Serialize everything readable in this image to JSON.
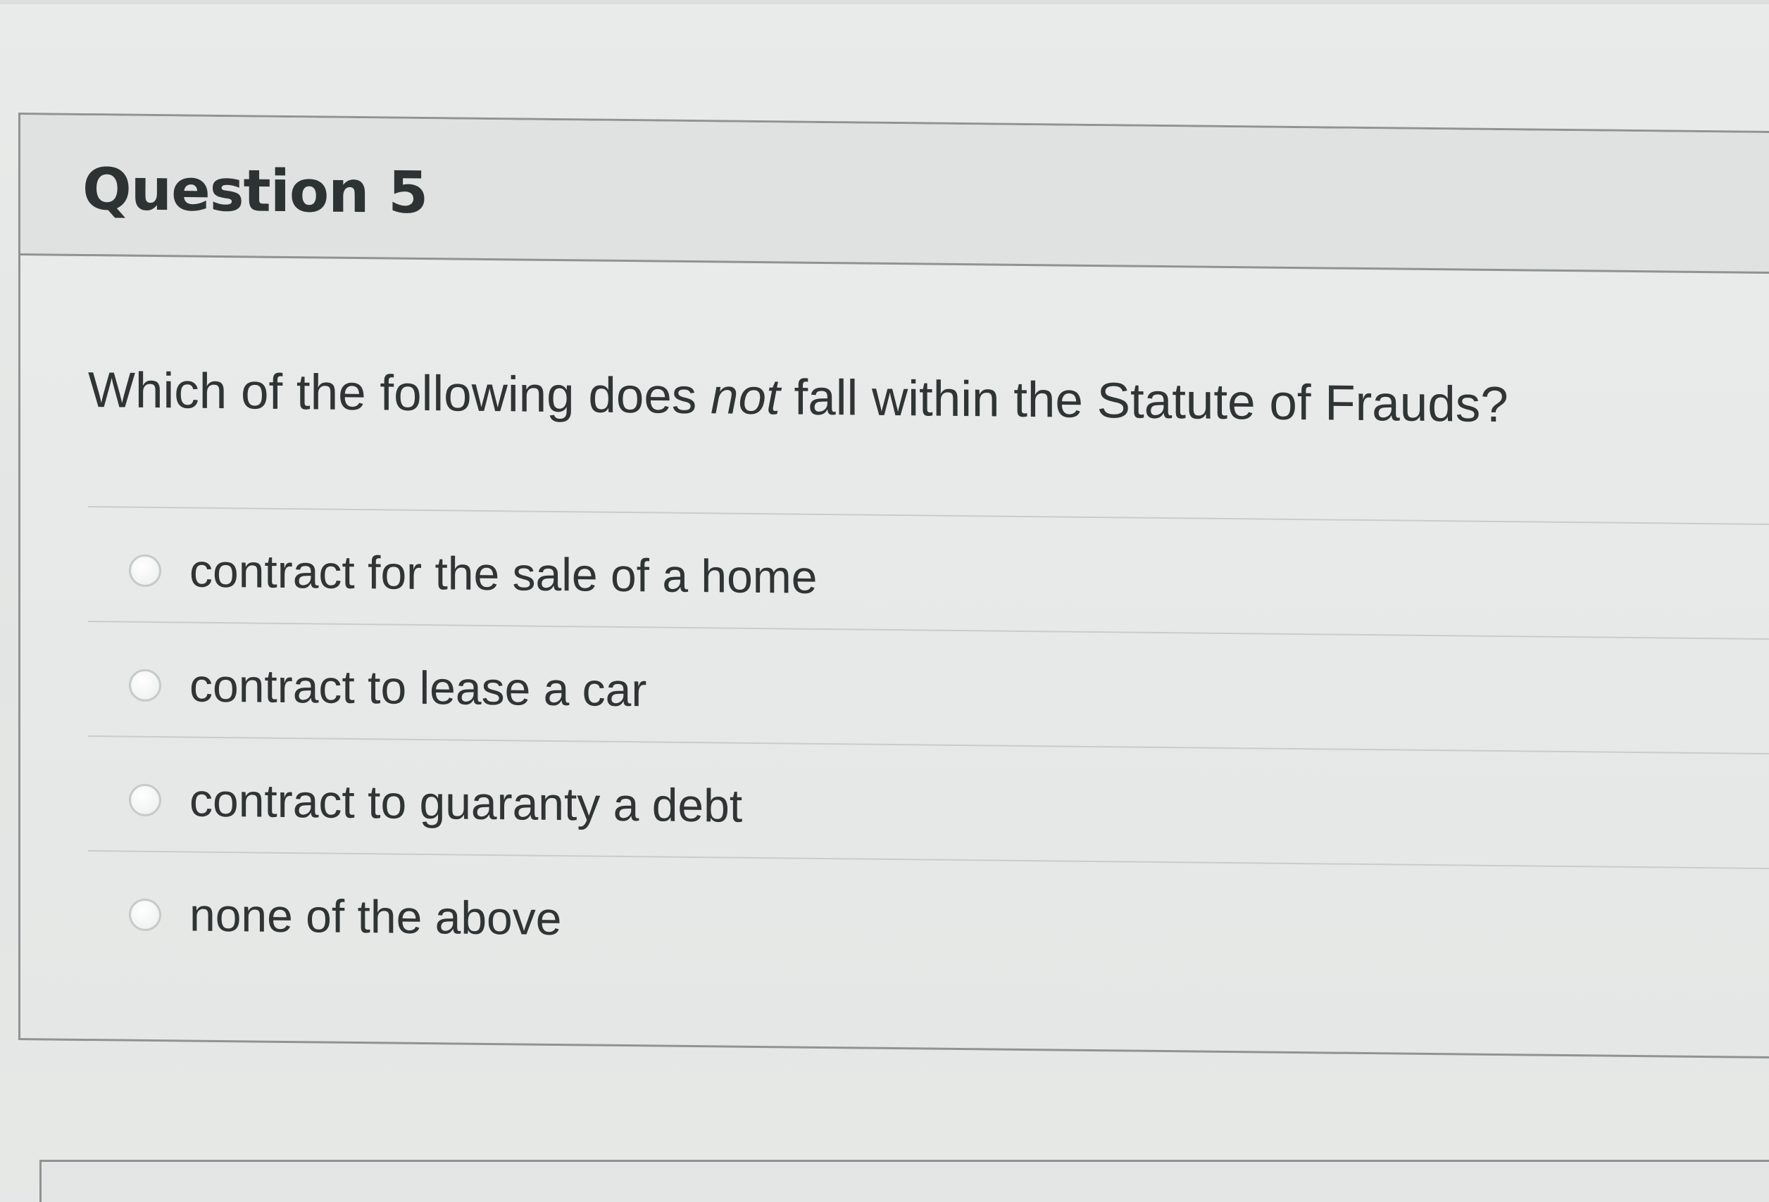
{
  "question": {
    "title": "Question 5",
    "prompt_before": "Which of the following does ",
    "prompt_emphasis": "not",
    "prompt_after": " fall within the Statute of Frauds?",
    "answers": [
      {
        "label": "contract for the sale of a home",
        "selected": false
      },
      {
        "label": "contract to lease a car",
        "selected": false
      },
      {
        "label": "contract to guaranty a debt",
        "selected": false
      },
      {
        "label": "none of the above",
        "selected": false
      }
    ]
  }
}
